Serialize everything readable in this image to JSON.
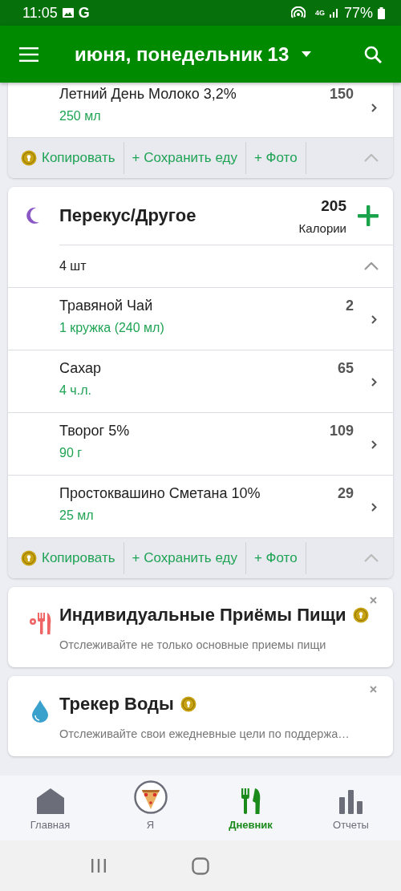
{
  "status_bar": {
    "time": "11:05",
    "carrier": "G",
    "network": "4G",
    "battery": "77%"
  },
  "app_bar": {
    "title": "июня, понедельник 13"
  },
  "top_meal": {
    "items": [
      {
        "name": "Летний День Молоко 3,2%",
        "amount": "250 мл",
        "calories": "150"
      }
    ],
    "actions": {
      "copy": "Копировать",
      "save": "+ Сохранить еду",
      "photo": "+ Фото"
    }
  },
  "meal": {
    "title": "Перекус/Другое",
    "calories": "205",
    "calories_label": "Калории",
    "count": "4 шт",
    "items": [
      {
        "name": "Травяной Чай",
        "amount": "1 кружка (240 мл)",
        "calories": "2"
      },
      {
        "name": "Сахар",
        "amount": "4 ч.л.",
        "calories": "65"
      },
      {
        "name": "Творог 5%",
        "amount": "90 г",
        "calories": "109"
      },
      {
        "name": "Простоквашино Сметана 10%",
        "amount": "25 мл",
        "calories": "29"
      }
    ],
    "actions": {
      "copy": "Копировать",
      "save": "+ Сохранить еду",
      "photo": "+ Фото"
    }
  },
  "promos": [
    {
      "kind": "meals",
      "title": "Индивидуальные Приёмы Пищи",
      "description": "Отслеживайте не только основные приемы пищи"
    },
    {
      "kind": "water",
      "title": "Трекер Воды",
      "description": "Отслеживайте свои ежедневные цели по поддержа…"
    }
  ],
  "nav": [
    {
      "kind": "home",
      "label": "Главная",
      "selected": false
    },
    {
      "kind": "me",
      "label": "Я",
      "selected": false
    },
    {
      "kind": "diary",
      "label": "Дневник",
      "selected": true
    },
    {
      "kind": "reports",
      "label": "Отчеты",
      "selected": false
    }
  ]
}
